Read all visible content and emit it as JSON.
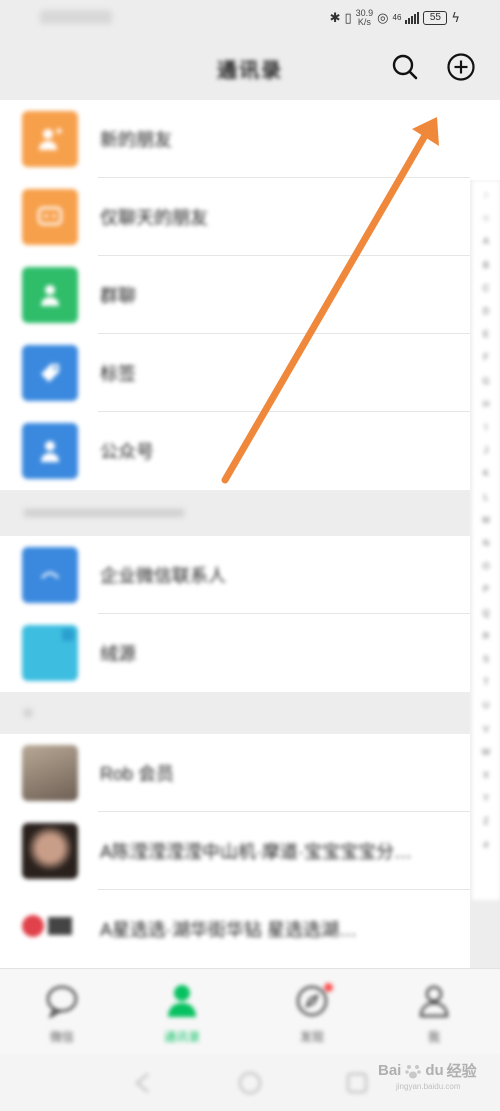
{
  "status_bar": {
    "time": "",
    "net_speed_value": "30.9",
    "net_speed_unit": "K/s",
    "signal_label": "46",
    "battery": "55"
  },
  "nav": {
    "title": "通讯录",
    "search_icon": "search-icon",
    "add_icon": "plus-circle-icon"
  },
  "top_entries": [
    {
      "label": "新的朋友",
      "color": "#f7a04b",
      "icon": "person-plus-icon"
    },
    {
      "label": "仅聊天的朋友",
      "color": "#f7a04b",
      "icon": "chat-icon"
    },
    {
      "label": "群聊",
      "color": "#2fbd6a",
      "icon": "group-icon"
    },
    {
      "label": "标签",
      "color": "#3b89de",
      "icon": "tag-icon"
    },
    {
      "label": "公众号",
      "color": "#3b89de",
      "icon": "person-icon"
    }
  ],
  "sections": {
    "enterprise_header": "",
    "contacts_header": ""
  },
  "enterprise_entries": [
    {
      "label": "企业微信联系人",
      "color": "#3b89de"
    },
    {
      "label": "绒源",
      "color": "#3dbde0"
    }
  ],
  "contacts": [
    {
      "label": "Rob 会员",
      "color": "#9e8f7f"
    },
    {
      "label": "A陈滢滢滢滢中山机·摩道·宝宝宝宝分…",
      "color": "#3a2f2a"
    },
    {
      "label": "A星选选·湖华街华钻 星选选湖…",
      "color": "#e0414a"
    }
  ],
  "index_letters": [
    "↑",
    "☆",
    "A",
    "B",
    "C",
    "D",
    "E",
    "F",
    "G",
    "H",
    "I",
    "J",
    "K",
    "L",
    "M",
    "N",
    "O",
    "P",
    "Q",
    "R",
    "S",
    "T",
    "U",
    "V",
    "W",
    "X",
    "Y",
    "Z",
    "#"
  ],
  "tabs": [
    {
      "label": "微信",
      "icon": "chat-bubble-icon",
      "active": false
    },
    {
      "label": "通讯录",
      "icon": "contacts-icon",
      "active": true
    },
    {
      "label": "发现",
      "icon": "compass-icon",
      "active": false
    },
    {
      "label": "我",
      "icon": "me-icon",
      "active": false
    }
  ],
  "watermark": {
    "brand": "Bai",
    "brand_suffix": "du",
    "text": "经验",
    "subtext": "jingyan.baidu.com"
  },
  "colors": {
    "accent_green": "#07c160",
    "annotation_arrow": "#f0883c",
    "badge_red": "#fa5151"
  }
}
